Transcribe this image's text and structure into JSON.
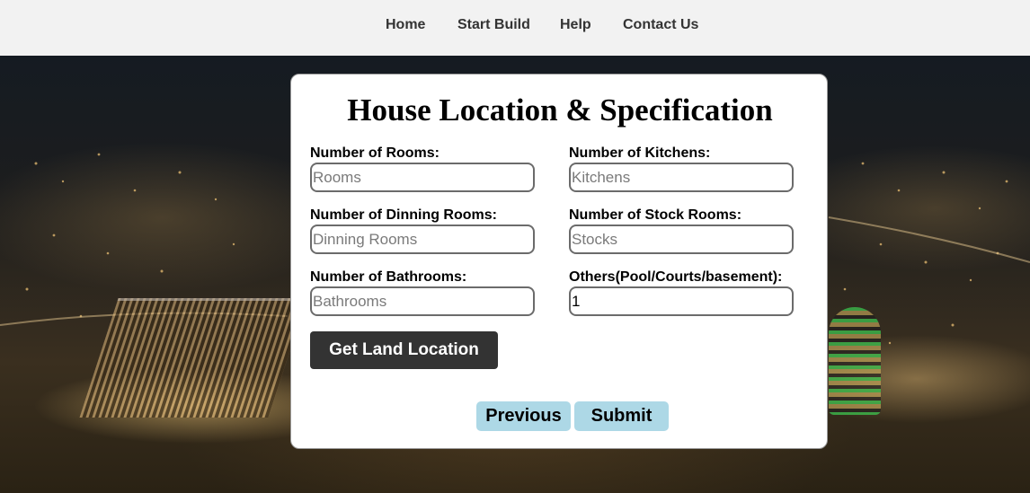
{
  "nav": {
    "items": [
      {
        "label": "Home"
      },
      {
        "label": "Start Build"
      },
      {
        "label": "Help"
      },
      {
        "label": "Contact Us"
      }
    ]
  },
  "form": {
    "title": "House Location & Specification",
    "fields": {
      "rooms": {
        "label": "Number of Rooms:",
        "placeholder": "Rooms",
        "value": ""
      },
      "kitchens": {
        "label": "Number of Kitchens:",
        "placeholder": "Kitchens",
        "value": ""
      },
      "dinning": {
        "label": "Number of Dinning Rooms:",
        "placeholder": "Dinning Rooms",
        "value": ""
      },
      "stock": {
        "label": "Number of Stock Rooms:",
        "placeholder": "Stocks",
        "value": ""
      },
      "bathrooms": {
        "label": "Number of Bathrooms:",
        "placeholder": "Bathrooms",
        "value": ""
      },
      "others": {
        "label": "Others(Pool/Courts/basement):",
        "placeholder": "",
        "value": "1"
      }
    },
    "land_button": "Get Land Location",
    "previous_button": "Previous",
    "submit_button": "Submit"
  },
  "colors": {
    "topbar": "#f2f2f2",
    "nav_text": "#333333",
    "land_button_bg": "#333333",
    "nav_buttons_bg": "#add8e6"
  }
}
